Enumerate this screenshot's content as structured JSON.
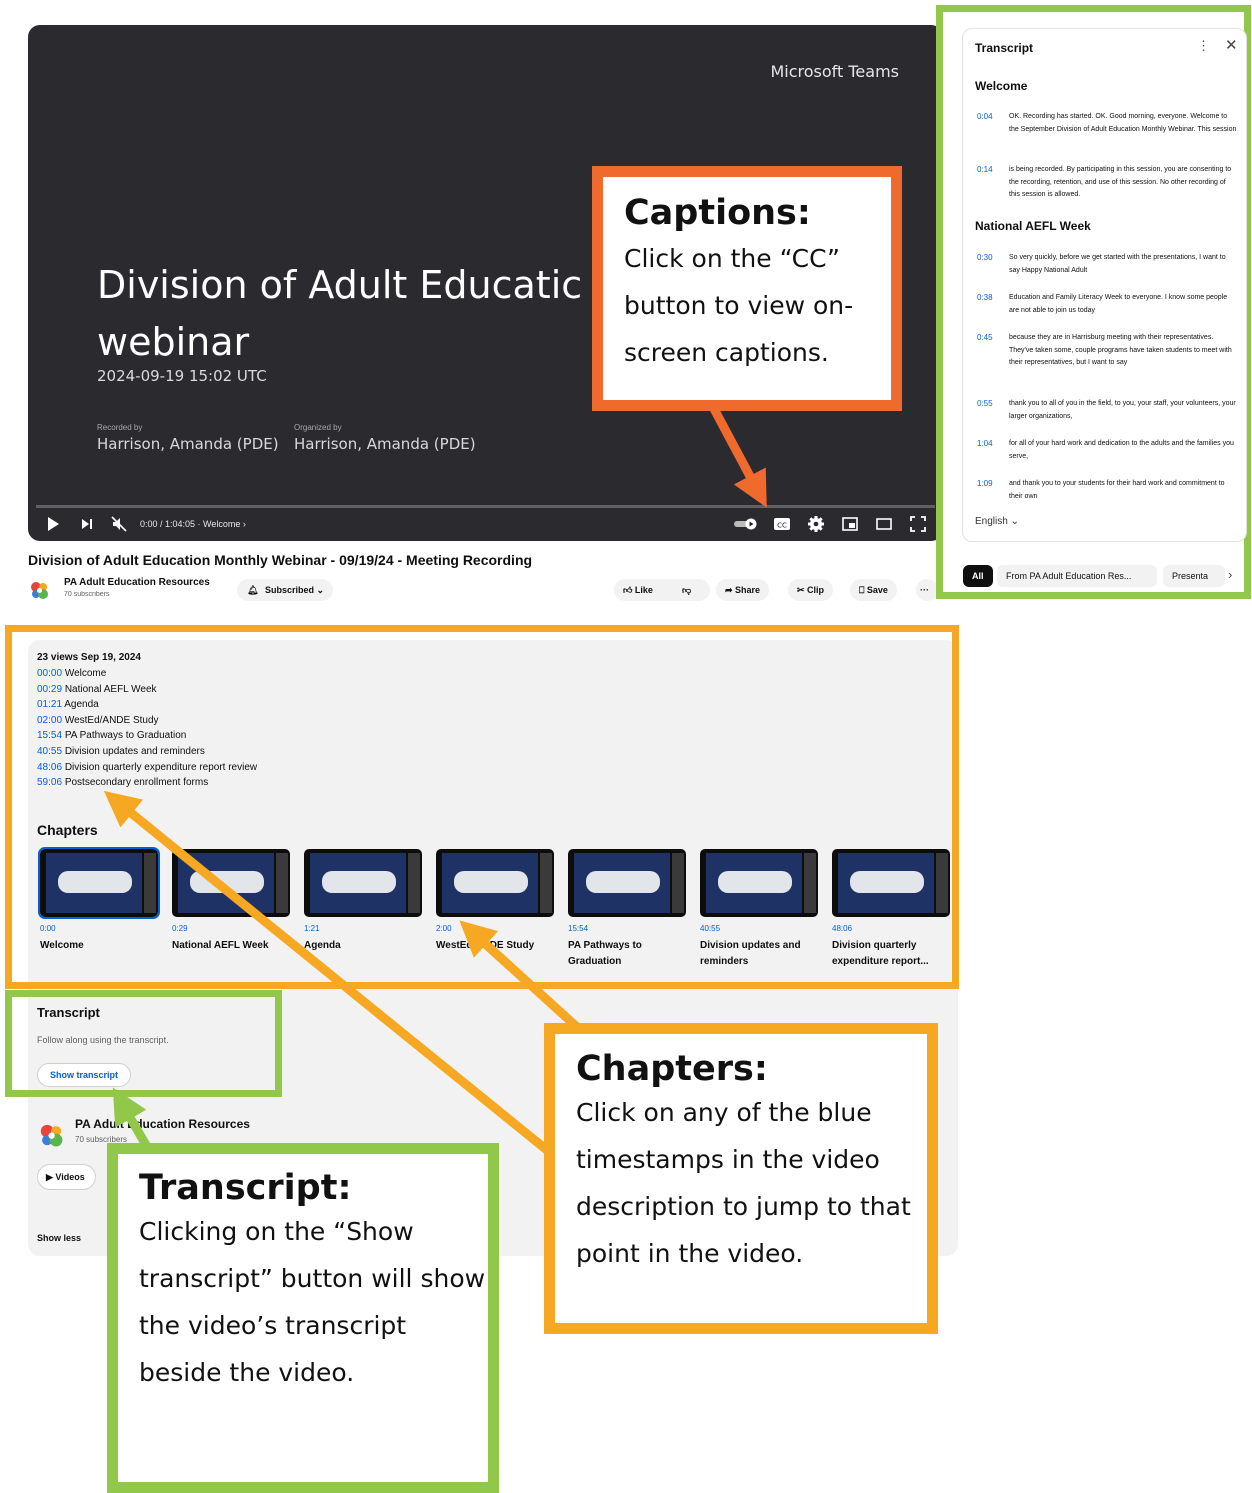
{
  "colors": {
    "orange": "#ef6a2c",
    "amber": "#f7a823",
    "green": "#92c84a",
    "link_blue": "#065fd4",
    "player_bg": "#2b2b2f"
  },
  "player": {
    "brand": "Microsoft Teams",
    "slide_title_line1": "Division of Adult Educatic",
    "slide_title_line2": "webinar",
    "slide_date": "2024-09-19 15:02 UTC",
    "recorded_by_label": "Recorded by",
    "recorded_by": "Harrison, Amanda (PDE)",
    "organized_by_label": "Organized by",
    "organized_by": "Harrison, Amanda (PDE)",
    "time": "0:00 / 1:04:05 · Welcome ›",
    "progress_fraction": 0.0,
    "icons": [
      "play-icon",
      "next-icon",
      "mute-icon",
      "autoplay-toggle-icon",
      "cc-icon",
      "settings-icon",
      "miniplayer-icon",
      "theater-icon",
      "fullscreen-icon"
    ]
  },
  "video": {
    "title": "Division of Adult Education Monthly Webinar - 09/19/24 - Meeting Recording",
    "channel": "PA Adult Education Resources",
    "subscribers": "70 subscribers",
    "subscribed_label": "Subscribed",
    "actions": {
      "like": "Like",
      "share": "Share",
      "clip": "Clip",
      "save": "Save",
      "more": "···"
    }
  },
  "transcript_panel": {
    "title": "Transcript",
    "sections": [
      {
        "heading": "Welcome",
        "segments": [
          {
            "ts": "0:04",
            "text": "OK. Recording has started. OK. Good morning, everyone. Welcome to the September Division of Adult Education Monthly Webinar. This session"
          },
          {
            "ts": "0:14",
            "text": "is being recorded. By participating in this session, you are consenting to the recording, retention, and use of this session. No other recording of this session is allowed."
          }
        ]
      },
      {
        "heading": "National AEFL Week",
        "segments": [
          {
            "ts": "0:30",
            "text": "So very quickly, before we get started with the presentations, I want to say Happy National Adult"
          },
          {
            "ts": "0:38",
            "text": "Education and Family Literacy Week to everyone. I know some people are not able to join us today"
          },
          {
            "ts": "0:45",
            "text": "because they are in Harrisburg meeting with their representatives. They've taken some, couple programs have taken students to meet with their representatives, but I want to say"
          },
          {
            "ts": "0:55",
            "text": "thank you to all of you in the field, to you, your staff, your volunteers, your larger organizations,"
          },
          {
            "ts": "1:04",
            "text": "for all of your hard work and dedication to the adults and the families you serve,"
          },
          {
            "ts": "1:09",
            "text": "and thank you to your students for their hard work and commitment to their own"
          }
        ]
      }
    ],
    "language": "English",
    "chips": [
      "All",
      "From PA Adult Education Res...",
      "Presenta"
    ]
  },
  "description": {
    "views_date": "23 views  Sep 19, 2024",
    "timestamps": [
      {
        "ts": "00:00",
        "label": "Welcome"
      },
      {
        "ts": "00:29",
        "label": "National AEFL Week"
      },
      {
        "ts": "01:21",
        "label": "Agenda"
      },
      {
        "ts": "02:00",
        "label": "WestEd/ANDE Study"
      },
      {
        "ts": "15:54",
        "label": "PA Pathways to Graduation"
      },
      {
        "ts": "40:55",
        "label": "Division updates and reminders"
      },
      {
        "ts": "48:06",
        "label": "Division quarterly expenditure report review"
      },
      {
        "ts": "59:06",
        "label": "Postsecondary enrollment forms"
      }
    ],
    "chapters_heading": "Chapters",
    "chapters": [
      {
        "ts": "0:00",
        "label": "Welcome"
      },
      {
        "ts": "0:29",
        "label": "National AEFL Week"
      },
      {
        "ts": "1:21",
        "label": "Agenda"
      },
      {
        "ts": "2:00",
        "label": "WestEd/ANDE Study"
      },
      {
        "ts": "15:54",
        "label": "PA Pathways to Graduation"
      },
      {
        "ts": "40:55",
        "label": "Division updates and reminders"
      },
      {
        "ts": "48:06",
        "label": "Division quarterly expenditure report..."
      }
    ],
    "transcript_heading": "Transcript",
    "transcript_sub": "Follow along using the transcript.",
    "show_transcript": "Show transcript",
    "channel": "PA Adult Education Resources",
    "subscribers": "70 subscribers",
    "videos_label": "Videos",
    "show_less": "Show less"
  },
  "callouts": {
    "captions": {
      "title": "Captions:",
      "body": "Click on the “CC” button to view on-screen captions."
    },
    "chapters": {
      "title": "Chapters:",
      "body": "Click on any of the blue timestamps in the video description to jump to that point in the video."
    },
    "transcript": {
      "title": "Transcript:",
      "body": "Clicking on the “Show transcript” button will show the video’s transcript beside the video."
    }
  }
}
